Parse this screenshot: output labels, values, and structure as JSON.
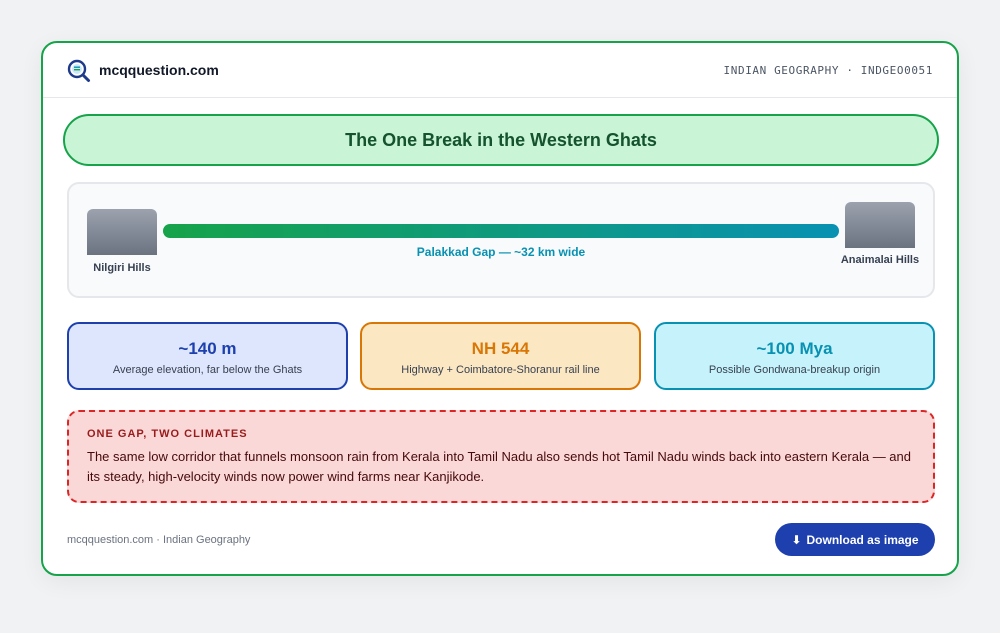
{
  "header": {
    "site_name": "mcqquestion.com",
    "meta": "INDIAN GEOGRAPHY · INDGEO0051",
    "logo_icon": "magnifier-logo-icon"
  },
  "title": "The One Break in the Western Ghats",
  "gap": {
    "left_hill": "Nilgiri Hills",
    "right_hill": "Anaimalai Hills",
    "label": "Palakkad Gap — ~32 km wide"
  },
  "stats": [
    {
      "value": "~140 m",
      "caption": "Average elevation, far below the Ghats",
      "color": "#1e40af"
    },
    {
      "value": "NH 544",
      "caption": "Highway + Coimbatore-Shoranur rail line",
      "color": "#d97706"
    },
    {
      "value": "~100 Mya",
      "caption": "Possible Gondwana-breakup origin",
      "color": "#0891b2"
    }
  ],
  "callout": {
    "heading": "ONE GAP, TWO CLIMATES",
    "body": "The same low corridor that funnels monsoon rain from Kerala into Tamil Nadu also sends hot Tamil Nadu winds back into eastern Kerala — and its steady, high-velocity winds now power wind farms near Kanjikode."
  },
  "footer": {
    "text": "mcqquestion.com · Indian Geography",
    "download_icon": "download-arrow-icon",
    "download_glyph": "⬇",
    "download_label": "Download as image"
  },
  "colors": {
    "accent_green": "#16a34a",
    "accent_blue": "#1e40af",
    "accent_teal": "#0891b2",
    "accent_amber": "#d97706",
    "accent_red": "#dc2626"
  }
}
